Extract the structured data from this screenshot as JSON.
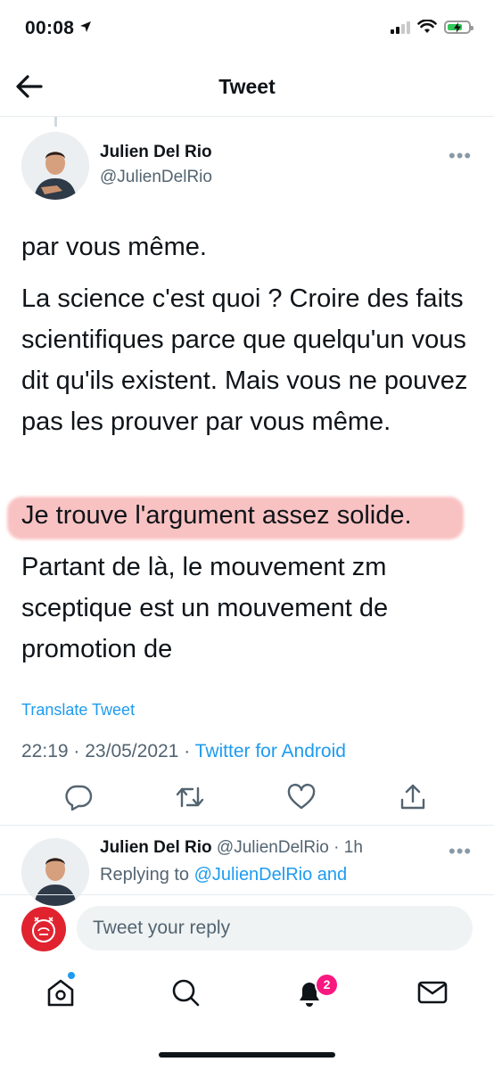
{
  "status_bar": {
    "time": "00:08"
  },
  "header": {
    "title": "Tweet"
  },
  "tweet": {
    "author_name": "Julien Del Rio",
    "author_handle": "@JulienDelRio",
    "paragraphs": [
      "par vous même.",
      "La science c'est quoi ? Croire des faits scientifiques parce que quelqu'un vous dit qu'ils existent. Mais vous ne pouvez pas les prouver par vous même.",
      "Je trouve l'argument assez solide.",
      "Partant de là, le mouvement zm sceptique est un mouvement de promotion de"
    ],
    "translate_label": "Translate Tweet",
    "time": "22:19",
    "separator": "·",
    "date": "23/05/2021",
    "source": "Twitter for Android"
  },
  "reply": {
    "author_name": "Julien Del Rio",
    "author_handle": "@JulienDelRio",
    "age": "1h",
    "replying_prefix": "Replying to",
    "replying_mention": "@JulienDelRio",
    "replying_suffix": "and"
  },
  "compose": {
    "placeholder": "Tweet your reply"
  },
  "tab_bar": {
    "notifications_count": "2"
  },
  "colors": {
    "accent": "#1d9bf0",
    "highlight": "#f06e6e",
    "badge": "#f91880",
    "profile_red": "#e0232f"
  }
}
